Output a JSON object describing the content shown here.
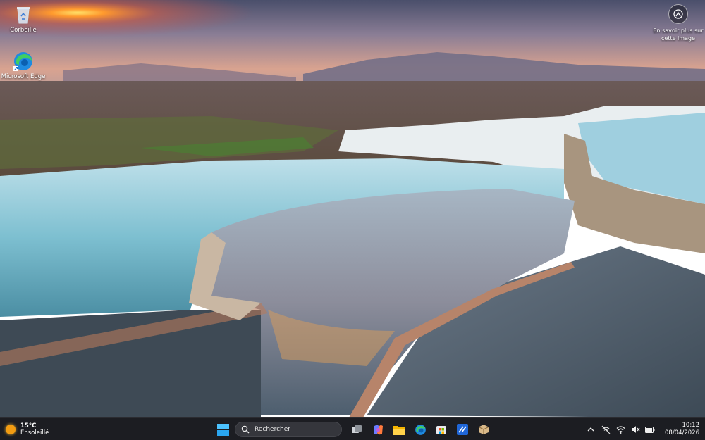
{
  "desktop": {
    "icons": [
      {
        "label": "Corbeille",
        "icon": "recycle-bin-icon"
      },
      {
        "label": "Microsoft Edge",
        "icon": "edge-icon"
      }
    ],
    "learn_more": {
      "line1": "En savoir plus sur",
      "line2": "cette image",
      "icon": "camera-info-icon"
    }
  },
  "taskbar": {
    "weather": {
      "temperature": "15°C",
      "condition": "Ensoleillé",
      "icon": "sun-icon"
    },
    "search": {
      "placeholder": "Rechercher",
      "icon": "search-icon"
    },
    "apps": [
      {
        "name": "windows-start",
        "icon": "windows-logo-icon"
      },
      {
        "name": "task-view",
        "icon": "task-view-icon"
      },
      {
        "name": "copilot",
        "icon": "copilot-icon"
      },
      {
        "name": "file-explorer",
        "icon": "folder-icon"
      },
      {
        "name": "edge",
        "icon": "edge-icon"
      },
      {
        "name": "microsoft-store",
        "icon": "store-icon"
      },
      {
        "name": "app-blue",
        "icon": "app-blue-icon"
      },
      {
        "name": "app-box",
        "icon": "package-icon"
      }
    ],
    "tray": {
      "icons": [
        "chevron-up-icon",
        "network-off-icon",
        "wifi-icon",
        "volume-muted-icon",
        "battery-icon"
      ]
    },
    "clock": {
      "time": "10:12",
      "date": "08/04/2026"
    }
  },
  "colors": {
    "taskbar_bg": "#1c1d22",
    "search_bg": "#35363c",
    "sun": "#f39c12"
  }
}
